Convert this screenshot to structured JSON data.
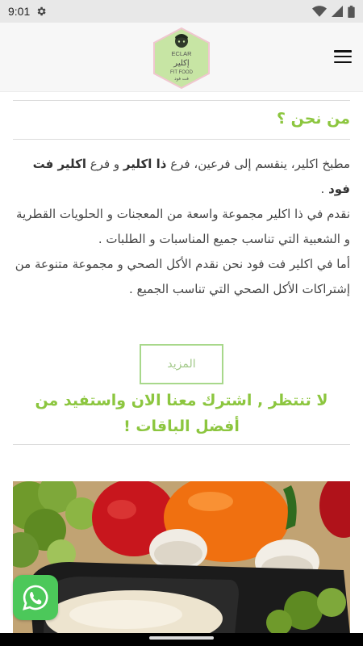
{
  "status_bar": {
    "time": "9:01",
    "icons": [
      "settings-icon",
      "wifi-icon",
      "signal-icon",
      "battery-icon"
    ]
  },
  "header": {
    "logo": {
      "name_latin": "ECLAR",
      "name_arabic": "إكلير",
      "tagline_latin": "FIT FOOD",
      "tagline_arabic": "فت فود"
    },
    "menu_icon": "hamburger-menu-icon"
  },
  "about": {
    "title": "من نحن ؟",
    "intro_1": "مطبخ اكلير، ينقسم إلى فرعين، فرع ",
    "branch_1": "ذا اكلير",
    "intro_2": " و فرع ",
    "branch_2": "اكلير فت فود",
    "intro_3": " .",
    "para_2": "نقدم في ذا اكلير مجموعة واسعة من المعجنات و الحلويات القطرية و الشعبية التي تناسب جميع المناسبات و الطلبات .",
    "para_3": "أما في اكلير فت فود نحن نقدم الأكل الصحي و مجموعة متنوعة من إشتراكات الأكل الصحي التي تناسب الجميع ."
  },
  "more_button": "المزيد",
  "cta": "لا تنتظر , اشترك معنا الان واستفيد من أفضل الباقات !",
  "hero_image": "healthy-food-vegetables-image",
  "whatsapp_icon": "whatsapp-icon",
  "colors": {
    "accent": "#8cc63f",
    "button_border": "#a8d88b",
    "whatsapp": "#4cc85a"
  }
}
